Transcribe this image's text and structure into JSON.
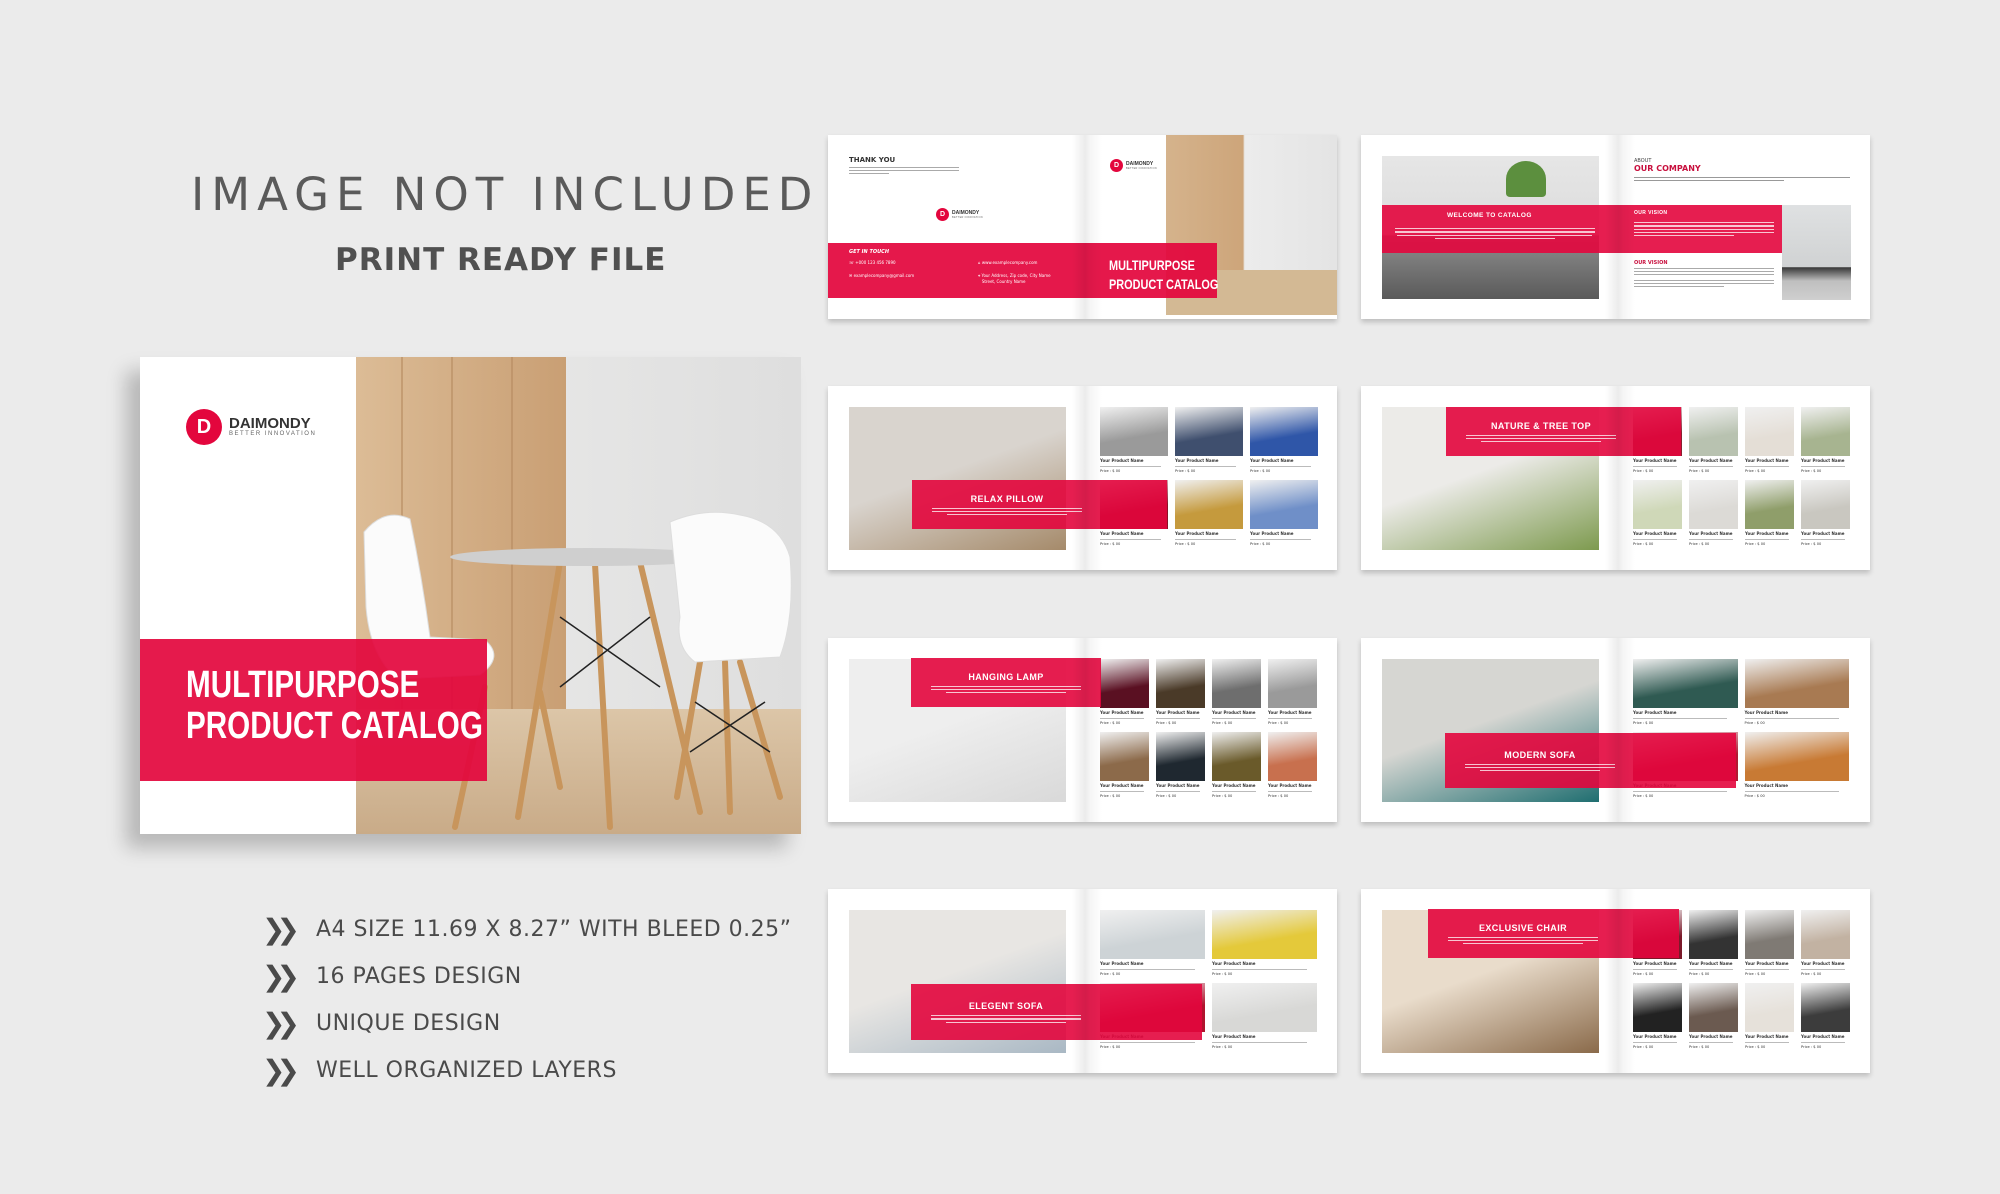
{
  "heading": {
    "title": "IMAGE NOT INCLUDED",
    "subtitle": "PRINT READY FILE"
  },
  "brand": {
    "name": "DAIMONDY",
    "tagline": "BETTER INNOVATION",
    "mark": "D"
  },
  "cover": {
    "title_line1": "MULTIPURPOSE",
    "title_line2": "PRODUCT CATALOG"
  },
  "features": [
    "A4 SIZE 11.69 X 8.27” WITH BLEED 0.25”",
    "16 PAGES DESIGN",
    "UNIQUE DESIGN",
    "WELL ORGANIZED LAYERS"
  ],
  "feature_icon": "double-chevron-right-icon",
  "spread_thankyou": {
    "heading": "THANK YOU",
    "contact_heading": "GET IN TOUCH",
    "phone": "+000 123 456 7890",
    "email": "examplecompany@gmail.com",
    "website": "www.examplecompany.com",
    "address": "Your Address, Zip code, City Name",
    "address2": "Street, Country Name"
  },
  "spread_about": {
    "welcome": "WELCOME TO CATALOG",
    "about_small": "ABOUT",
    "about_title": "OUR COMPANY",
    "vision_1": "OUR VISION",
    "vision_2": "OUR VISION"
  },
  "product_card": {
    "name": "Your Product Name",
    "price": "Price : $ 00"
  },
  "product_spreads": [
    {
      "title": "RELAX PILLOW",
      "hero_colors": [
        "#d9d4ce",
        "#a58a6a"
      ],
      "tiles": [
        "#9a9a9a",
        "#3f4f6e",
        "#2f56a8",
        "#8a1026",
        "#c59a3d",
        "#6f8fc8"
      ]
    },
    {
      "title": "NATURE & TREE TOP",
      "hero_colors": [
        "#ecebe8",
        "#7d9a4e"
      ],
      "tiles": [
        "#8a2030",
        "#b8c2b0",
        "#e4ded6",
        "#a7b490",
        "#cfd8b8",
        "#dcdad6",
        "#8f9e6a",
        "#c9c7c0"
      ]
    },
    {
      "title": "HANGING LAMP",
      "hero_colors": [
        "#eeeeee",
        "#d9d9d9"
      ],
      "tiles": [
        "#5a1022",
        "#4a3a28",
        "#6e6e6e",
        "#9a9a9a",
        "#8c6a4a",
        "#1f2830",
        "#6a5a2a",
        "#c8704e"
      ]
    },
    {
      "title": "MODERN SOFA",
      "hero_colors": [
        "#d6d6d2",
        "#1f6e70"
      ],
      "tiles": [
        "#2f5a52",
        "#a87a52",
        "#b01a32",
        "#c87a34"
      ]
    },
    {
      "title": "ELEGENT SOFA",
      "hero_colors": [
        "#e8e6e3",
        "#a9b8c4"
      ],
      "tiles": [
        "#cdd3d6",
        "#e4c93a",
        "#b0142e",
        "#d8d8d6"
      ]
    },
    {
      "title": "EXCLUSIVE CHAIR",
      "hero_colors": [
        "#e9dccb",
        "#8a6a4a"
      ],
      "tiles": [
        "#7a1a2a",
        "#333333",
        "#7f7a74",
        "#c2b2a2",
        "#222222",
        "#6b5a50",
        "#e6e1da",
        "#3c3c3c"
      ]
    }
  ],
  "colors": {
    "accent": "#e3063d",
    "background": "#ebebeb",
    "text": "#505050"
  }
}
